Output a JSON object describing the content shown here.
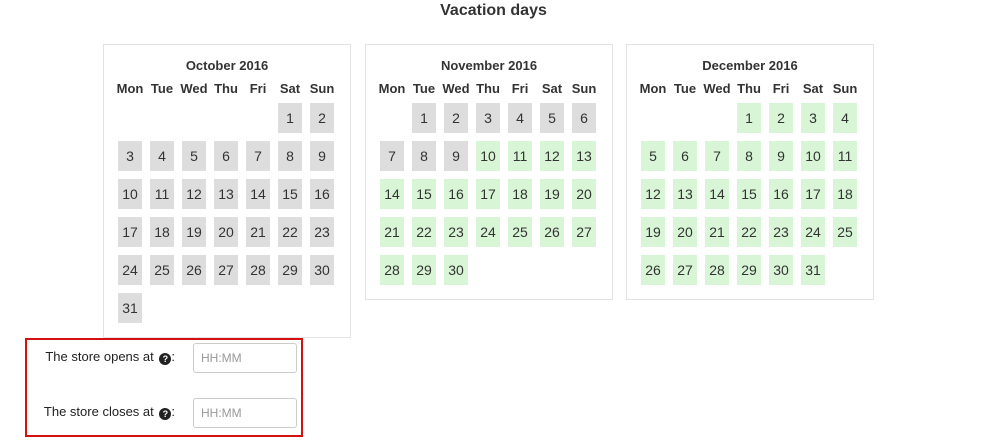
{
  "page": {
    "title": "Vacation days"
  },
  "weekdays": [
    "Mon",
    "Tue",
    "Wed",
    "Thu",
    "Fri",
    "Sat",
    "Sun"
  ],
  "colors": {
    "past_day": "#dddddd",
    "available_day": "#d8f5d6",
    "highlight_border": "#d41010"
  },
  "calendars": [
    {
      "month": "October 2016",
      "weeks": [
        [
          null,
          null,
          null,
          null,
          null,
          {
            "d": "1",
            "s": "past"
          },
          {
            "d": "2",
            "s": "past"
          }
        ],
        [
          {
            "d": "3",
            "s": "past"
          },
          {
            "d": "4",
            "s": "past"
          },
          {
            "d": "5",
            "s": "past"
          },
          {
            "d": "6",
            "s": "past"
          },
          {
            "d": "7",
            "s": "past"
          },
          {
            "d": "8",
            "s": "past"
          },
          {
            "d": "9",
            "s": "past"
          }
        ],
        [
          {
            "d": "10",
            "s": "past"
          },
          {
            "d": "11",
            "s": "past"
          },
          {
            "d": "12",
            "s": "past"
          },
          {
            "d": "13",
            "s": "past"
          },
          {
            "d": "14",
            "s": "past"
          },
          {
            "d": "15",
            "s": "past"
          },
          {
            "d": "16",
            "s": "past"
          }
        ],
        [
          {
            "d": "17",
            "s": "past"
          },
          {
            "d": "18",
            "s": "past"
          },
          {
            "d": "19",
            "s": "past"
          },
          {
            "d": "20",
            "s": "past"
          },
          {
            "d": "21",
            "s": "past"
          },
          {
            "d": "22",
            "s": "past"
          },
          {
            "d": "23",
            "s": "past"
          }
        ],
        [
          {
            "d": "24",
            "s": "past"
          },
          {
            "d": "25",
            "s": "past"
          },
          {
            "d": "26",
            "s": "past"
          },
          {
            "d": "27",
            "s": "past"
          },
          {
            "d": "28",
            "s": "past"
          },
          {
            "d": "29",
            "s": "past"
          },
          {
            "d": "30",
            "s": "past"
          }
        ],
        [
          {
            "d": "31",
            "s": "past"
          },
          null,
          null,
          null,
          null,
          null,
          null
        ]
      ]
    },
    {
      "month": "November 2016",
      "weeks": [
        [
          null,
          {
            "d": "1",
            "s": "past"
          },
          {
            "d": "2",
            "s": "past"
          },
          {
            "d": "3",
            "s": "past"
          },
          {
            "d": "4",
            "s": "past"
          },
          {
            "d": "5",
            "s": "past"
          },
          {
            "d": "6",
            "s": "past"
          }
        ],
        [
          {
            "d": "7",
            "s": "past"
          },
          {
            "d": "8",
            "s": "past"
          },
          {
            "d": "9",
            "s": "past"
          },
          {
            "d": "10",
            "s": "avail"
          },
          {
            "d": "11",
            "s": "avail"
          },
          {
            "d": "12",
            "s": "avail"
          },
          {
            "d": "13",
            "s": "avail"
          }
        ],
        [
          {
            "d": "14",
            "s": "avail"
          },
          {
            "d": "15",
            "s": "avail"
          },
          {
            "d": "16",
            "s": "avail"
          },
          {
            "d": "17",
            "s": "avail"
          },
          {
            "d": "18",
            "s": "avail"
          },
          {
            "d": "19",
            "s": "avail"
          },
          {
            "d": "20",
            "s": "avail"
          }
        ],
        [
          {
            "d": "21",
            "s": "avail"
          },
          {
            "d": "22",
            "s": "avail"
          },
          {
            "d": "23",
            "s": "avail"
          },
          {
            "d": "24",
            "s": "avail"
          },
          {
            "d": "25",
            "s": "avail"
          },
          {
            "d": "26",
            "s": "avail"
          },
          {
            "d": "27",
            "s": "avail"
          }
        ],
        [
          {
            "d": "28",
            "s": "avail"
          },
          {
            "d": "29",
            "s": "avail"
          },
          {
            "d": "30",
            "s": "avail"
          },
          null,
          null,
          null,
          null
        ]
      ]
    },
    {
      "month": "December 2016",
      "weeks": [
        [
          null,
          null,
          null,
          {
            "d": "1",
            "s": "avail"
          },
          {
            "d": "2",
            "s": "avail"
          },
          {
            "d": "3",
            "s": "avail"
          },
          {
            "d": "4",
            "s": "avail"
          }
        ],
        [
          {
            "d": "5",
            "s": "avail"
          },
          {
            "d": "6",
            "s": "avail"
          },
          {
            "d": "7",
            "s": "avail"
          },
          {
            "d": "8",
            "s": "avail"
          },
          {
            "d": "9",
            "s": "avail"
          },
          {
            "d": "10",
            "s": "avail"
          },
          {
            "d": "11",
            "s": "avail"
          }
        ],
        [
          {
            "d": "12",
            "s": "avail"
          },
          {
            "d": "13",
            "s": "avail"
          },
          {
            "d": "14",
            "s": "avail"
          },
          {
            "d": "15",
            "s": "avail"
          },
          {
            "d": "16",
            "s": "avail"
          },
          {
            "d": "17",
            "s": "avail"
          },
          {
            "d": "18",
            "s": "avail"
          }
        ],
        [
          {
            "d": "19",
            "s": "avail"
          },
          {
            "d": "20",
            "s": "avail"
          },
          {
            "d": "21",
            "s": "avail"
          },
          {
            "d": "22",
            "s": "avail"
          },
          {
            "d": "23",
            "s": "avail"
          },
          {
            "d": "24",
            "s": "avail"
          },
          {
            "d": "25",
            "s": "avail"
          }
        ],
        [
          {
            "d": "26",
            "s": "avail"
          },
          {
            "d": "27",
            "s": "avail"
          },
          {
            "d": "28",
            "s": "avail"
          },
          {
            "d": "29",
            "s": "avail"
          },
          {
            "d": "30",
            "s": "avail"
          },
          {
            "d": "31",
            "s": "avail"
          },
          null
        ]
      ]
    }
  ],
  "store_hours": {
    "opens_label": "The store opens at",
    "closes_label": "The store closes at",
    "opens_value": "",
    "closes_value": "",
    "opens_placeholder": "HH:MM",
    "closes_placeholder": "HH:MM",
    "help_icon": "question-circle-icon",
    "colon": ":"
  }
}
